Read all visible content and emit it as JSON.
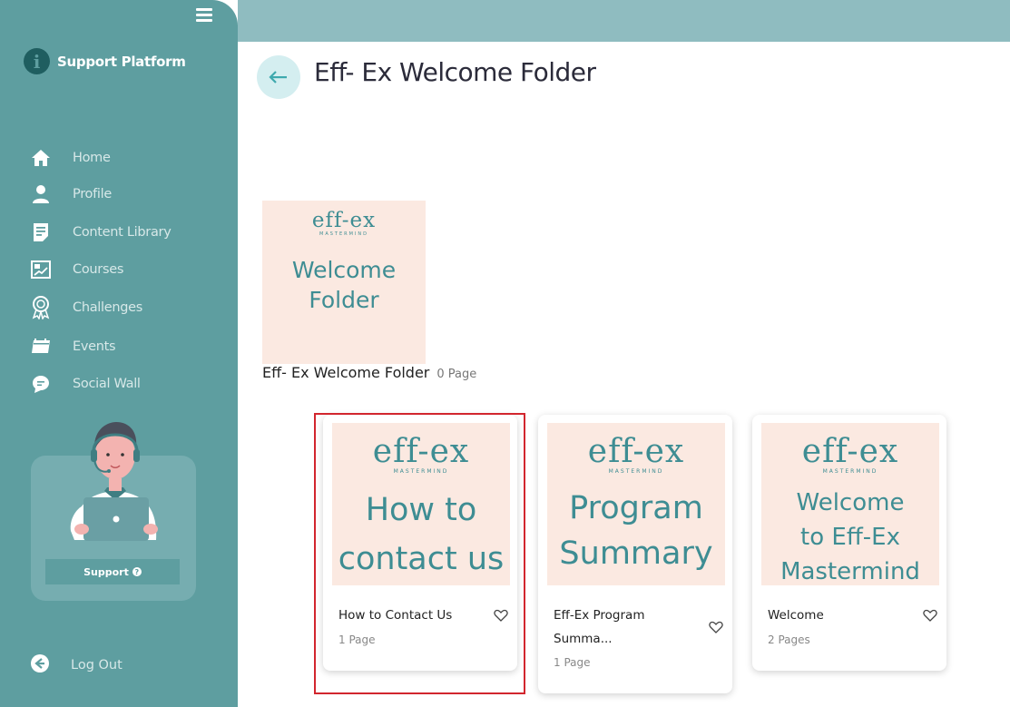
{
  "sidebar": {
    "brand": "Support Platform",
    "nav": [
      {
        "label": "Home",
        "icon": "home-icon"
      },
      {
        "label": "Profile",
        "icon": "user-icon"
      },
      {
        "label": "Content Library",
        "icon": "document-icon"
      },
      {
        "label": "Courses",
        "icon": "chart-board-icon"
      },
      {
        "label": "Challenges",
        "icon": "award-icon"
      },
      {
        "label": "Events",
        "icon": "calendar-icon"
      },
      {
        "label": "Social Wall",
        "icon": "chat-bubble-icon"
      }
    ],
    "support_label": "Support",
    "logout_label": "Log Out"
  },
  "header": {
    "title": "Eff- Ex Welcome Folder"
  },
  "folder": {
    "logo": "eff-ex",
    "logo_sub": "MASTERMIND",
    "thumb_line1": "Welcome",
    "thumb_line2": "Folder",
    "name": "Eff- Ex Welcome Folder",
    "count": "0 Page"
  },
  "cards": [
    {
      "thumb_line1": "How to",
      "thumb_line2": "contact us",
      "thumb_line3": "",
      "title": "How to Contact Us",
      "pages": "1 Page"
    },
    {
      "thumb_line1": "Program",
      "thumb_line2": "Summary",
      "thumb_line3": "",
      "title": "Eff-Ex Program Summa...",
      "pages": "1 Page"
    },
    {
      "thumb_line1": "Welcome",
      "thumb_line2": "to Eff-Ex",
      "thumb_line3": "Mastermind",
      "title": "Welcome",
      "pages": "2 Pages"
    }
  ],
  "colors": {
    "sidebar": "#5e9ea0",
    "topbar": "#8fbcc0",
    "thumb_bg": "#fbe9e1",
    "accent_text": "#3e8d93",
    "highlight": "#d2262e"
  }
}
